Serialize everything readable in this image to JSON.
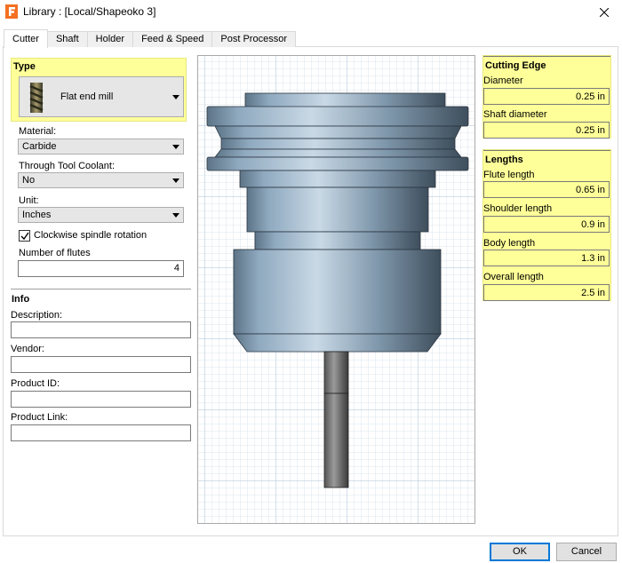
{
  "window": {
    "title": "Library :  [Local/Shapeoko 3]",
    "app_icon": "fusion-f-icon",
    "close_icon": "close-icon"
  },
  "tabs": [
    {
      "label": "Cutter",
      "active": true
    },
    {
      "label": "Shaft"
    },
    {
      "label": "Holder"
    },
    {
      "label": "Feed & Speed"
    },
    {
      "label": "Post Processor"
    }
  ],
  "type_section": {
    "title": "Type",
    "selected_type": "Flat end mill"
  },
  "material": {
    "label": "Material:",
    "value": "Carbide"
  },
  "coolant": {
    "label": "Through Tool Coolant:",
    "value": "No"
  },
  "unit": {
    "label": "Unit:",
    "value": "Inches"
  },
  "clockwise": {
    "label": "Clockwise spindle rotation",
    "checked": true
  },
  "flutes": {
    "label": "Number of flutes",
    "value": "4"
  },
  "info": {
    "title": "Info",
    "description_label": "Description:",
    "vendor_label": "Vendor:",
    "product_id_label": "Product ID:",
    "product_link_label": "Product Link:",
    "description": "",
    "vendor": "",
    "product_id": "",
    "product_link": ""
  },
  "cutting_edge": {
    "title": "Cutting Edge",
    "diameter_label": "Diameter",
    "diameter": "0.25 in",
    "shaft_diameter_label": "Shaft diameter",
    "shaft_diameter": "0.25 in"
  },
  "lengths": {
    "title": "Lengths",
    "flute_label": "Flute length",
    "flute": "0.65 in",
    "shoulder_label": "Shoulder length",
    "shoulder": "0.9 in",
    "body_label": "Body length",
    "body": "1.3 in",
    "overall_label": "Overall length",
    "overall": "2.5 in"
  },
  "buttons": {
    "ok": "OK",
    "cancel": "Cancel"
  },
  "colors": {
    "highlight": "#ffff99",
    "accent": "#0078d7",
    "holder": "#6f8fa9"
  }
}
